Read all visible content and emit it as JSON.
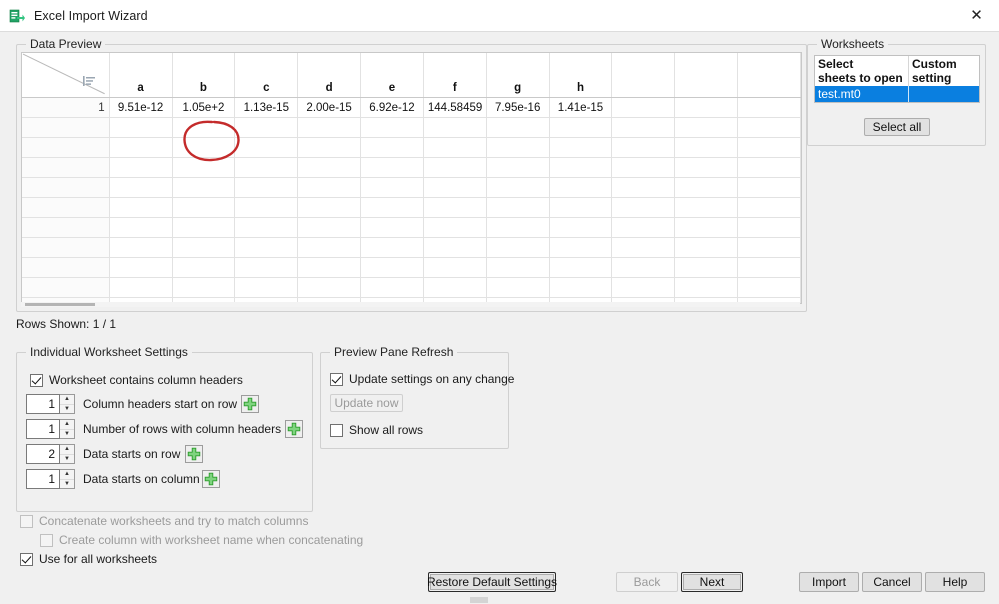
{
  "window": {
    "title": "Excel Import Wizard",
    "icon": "excel-import-icon",
    "close_label": "✕"
  },
  "data_preview": {
    "group_title": "Data Preview",
    "corner_icon": "sort-rows-icon",
    "columns": [
      "a",
      "b",
      "c",
      "d",
      "e",
      "f",
      "g",
      "h",
      "",
      "",
      ""
    ],
    "rows": [
      {
        "number": "1",
        "values": [
          "9.51e-12",
          "1.05e+2",
          "1.13e-15",
          "2.00e-15",
          "6.92e-12",
          "144.58459",
          "7.95e-16",
          "1.41e-15",
          "",
          "",
          ""
        ]
      }
    ],
    "empty_row_count": 11,
    "annotation": {
      "type": "hand-drawn-circle",
      "color": "#cc2222",
      "targets": "column b header and value 1.05e+2"
    },
    "rows_shown_label": "Rows Shown: 1 / 1"
  },
  "worksheets": {
    "group_title": "Worksheets",
    "headers": [
      "Select\nsheets to open",
      "Custom\nsetting"
    ],
    "header_col1_line1": "Select",
    "header_col1_line2": "sheets to open",
    "header_col2_line1": "Custom",
    "header_col2_line2": "setting",
    "rows": [
      {
        "name": "test.mt0",
        "custom_setting": "",
        "selected": true
      }
    ],
    "select_all_label": "Select all",
    "selection_color": "#0a7fe0"
  },
  "individual_worksheet_settings": {
    "group_title": "Individual Worksheet Settings",
    "contains_headers": {
      "label": "Worksheet contains column headers",
      "checked": true
    },
    "fields": [
      {
        "value": "1",
        "label": "Column headers start on row",
        "has_plus": true
      },
      {
        "value": "1",
        "label": "Number of rows with column headers",
        "has_plus": true
      },
      {
        "value": "2",
        "label": "Data starts on row",
        "has_plus": true
      },
      {
        "value": "1",
        "label": "Data starts on column",
        "has_plus": true
      }
    ]
  },
  "preview_pane_refresh": {
    "group_title": "Preview Pane Refresh",
    "update_on_change": {
      "label": "Update settings on any change",
      "checked": true
    },
    "update_now_label": "Update now",
    "update_now_enabled": false,
    "show_all_rows": {
      "label": "Show all rows",
      "checked": false
    }
  },
  "bottom_options": [
    {
      "label": "Concatenate worksheets and try to match columns",
      "checked": false,
      "enabled": false
    },
    {
      "label": "Create column with worksheet name when concatenating",
      "checked": false,
      "enabled": false
    },
    {
      "label": "Use for all worksheets",
      "checked": true,
      "enabled": true
    }
  ],
  "buttons": {
    "restore": {
      "label": "Restore Default Settings",
      "enabled": true
    },
    "back": {
      "label": "Back",
      "enabled": false
    },
    "next": {
      "label": "Next",
      "enabled": true,
      "focused": true
    },
    "import": {
      "label": "Import",
      "enabled": true
    },
    "cancel": {
      "label": "Cancel",
      "enabled": true
    },
    "help": {
      "label": "Help",
      "enabled": true
    }
  }
}
